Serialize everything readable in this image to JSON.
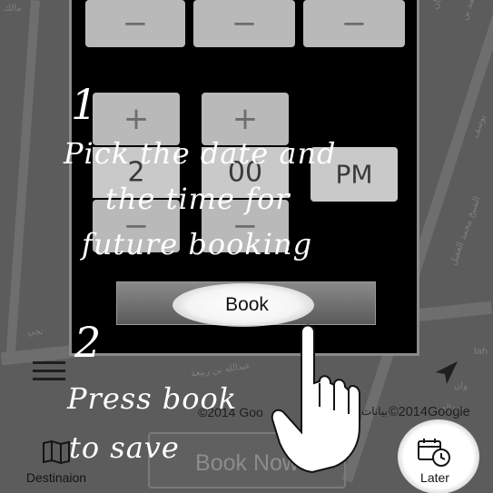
{
  "picker": {
    "top_row": [
      "−",
      "−",
      "−"
    ],
    "plus_row": [
      "+",
      "+"
    ],
    "hour": "2",
    "minute": "00",
    "ampm": "PM",
    "minus_row": [
      "−",
      "−"
    ]
  },
  "book_button": {
    "label": "Book"
  },
  "map": {
    "copyright_left": "©2014 Goo",
    "copyright_right": "©2014Google",
    "data_label": "بيانات",
    "street_labels": [
      "مالك",
      "أحمد السليمان",
      "محمد بن",
      "يوسف",
      "الشيخ محمد العقيل",
      "عبدالله بن ربيعة",
      "عبداله",
      "وان",
      "تجي",
      "lah"
    ]
  },
  "bottom_bar": {
    "book_now_label": "Book Now",
    "destination_label": "Destinaion",
    "later_label": "Later"
  },
  "tutorial": {
    "step1_number": "1",
    "step1_line1": "Pick the date and",
    "step1_line2": "the time for",
    "step1_line3": "future booking",
    "step2_number": "2",
    "step2_line1": "Press book",
    "step2_line2": "to save"
  },
  "icons": {
    "menu": "menu-icon",
    "navigation": "navigation-arrow-icon",
    "destination": "map-book-icon",
    "later": "calendar-clock-icon",
    "pointer": "pointing-hand-icon"
  }
}
